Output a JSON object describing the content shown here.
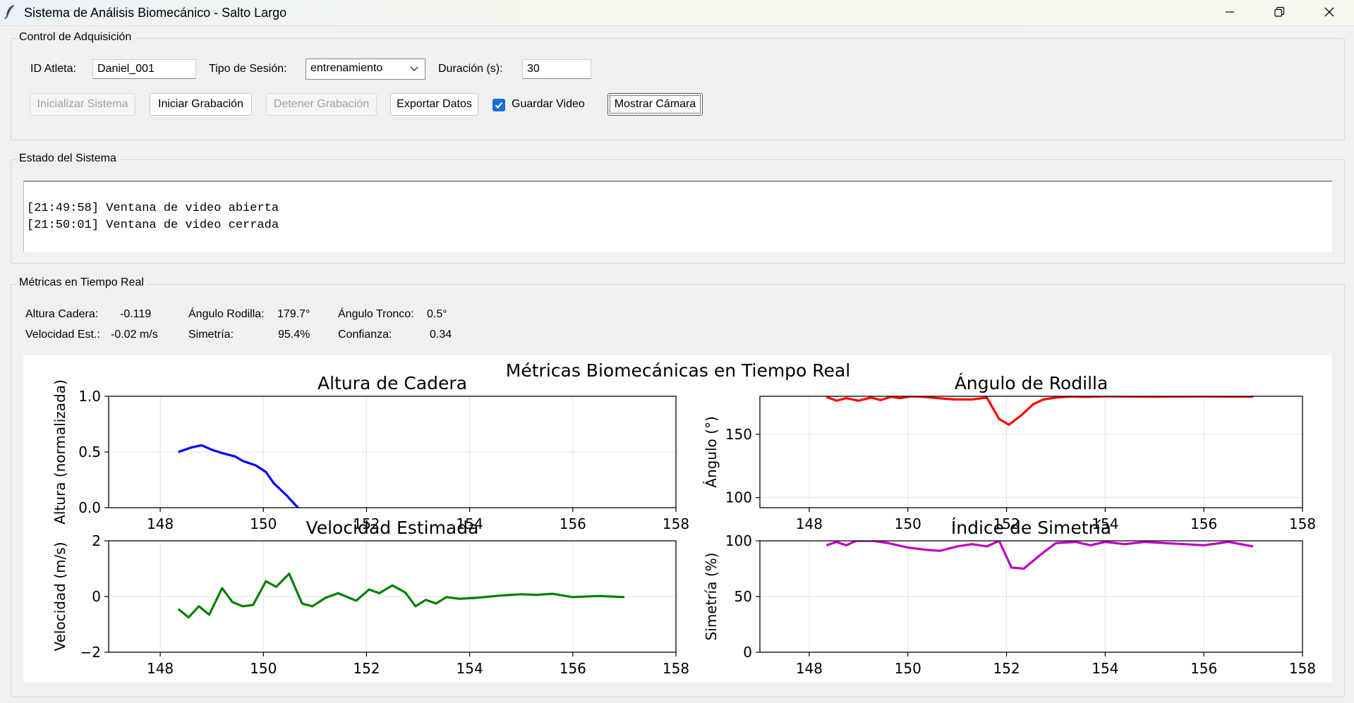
{
  "window": {
    "title": "Sistema de Análisis Biomecánico - Salto Largo",
    "controls": {
      "minimize": "minimize-icon",
      "restore": "restore-icon",
      "close": "close-icon"
    }
  },
  "acquisition": {
    "group_label": "Control de Adquisición",
    "athlete_label": "ID Atleta:",
    "athlete_value": "Daniel_001",
    "session_label": "Tipo de Sesión:",
    "session_value": "entrenamiento",
    "duration_label": "Duración (s):",
    "duration_value": "30",
    "buttons": {
      "init": "Inicializar Sistema",
      "start": "Iniciar Grabación",
      "stop": "Detener Grabación",
      "export": "Exportar Datos",
      "show_camera": "Mostrar Cámara"
    },
    "save_video_label": "Guardar Video",
    "save_video_checked": true
  },
  "status": {
    "group_label": "Estado del Sistema",
    "log": "[21:49:58] Ventana de video abierta\n[21:50:01] Ventana de video cerrada"
  },
  "metrics": {
    "group_label": "Métricas en Tiempo Real",
    "hip_height_label": "Altura Cadera:",
    "hip_height_value": "-0.119",
    "knee_angle_label": "Ángulo Rodilla:",
    "knee_angle_value": "179.7°",
    "trunk_angle_label": "Ángulo Tronco:",
    "trunk_angle_value": "0.5°",
    "velocity_label": "Velocidad Est.:",
    "velocity_value": "-0.02 m/s",
    "symmetry_label": "Simetría:",
    "symmetry_value": "95.4%",
    "confidence_label": "Confianza:",
    "confidence_value": "0.34"
  },
  "figure": {
    "suptitle": "Métricas Biomecánicas en Tiempo Real"
  },
  "chart_data": [
    {
      "type": "line",
      "title": "Altura de Cadera",
      "xlabel": "",
      "ylabel": "Altura (normalizada)",
      "color": "#0000ff",
      "xlim": [
        147,
        158
      ],
      "ylim": [
        0,
        1
      ],
      "xticks": [
        148,
        150,
        152,
        154,
        156,
        158
      ],
      "yticks": [
        0.0,
        0.5,
        1.0
      ],
      "ytick_labels": [
        "0.0",
        "0.5",
        "1.0"
      ],
      "grid": true,
      "x": [
        148.35,
        148.6,
        148.8,
        149.0,
        149.2,
        149.45,
        149.6,
        149.85,
        150.05,
        150.2,
        150.45,
        150.65,
        150.9
      ],
      "y": [
        0.5,
        0.54,
        0.56,
        0.52,
        0.49,
        0.46,
        0.42,
        0.38,
        0.32,
        0.22,
        0.11,
        0.01,
        -0.1
      ]
    },
    {
      "type": "line",
      "title": "Ángulo de Rodilla",
      "xlabel": "",
      "ylabel": "Ángulo (°)",
      "color": "#ff0000",
      "xlim": [
        147,
        158
      ],
      "ylim": [
        92,
        180
      ],
      "xticks": [
        148,
        150,
        152,
        154,
        156,
        158
      ],
      "yticks": [
        100,
        150
      ],
      "ytick_labels": [
        "100",
        "150"
      ],
      "grid": true,
      "x": [
        148.35,
        148.55,
        148.75,
        149.0,
        149.25,
        149.45,
        149.65,
        149.85,
        150.05,
        150.35,
        150.6,
        150.95,
        151.3,
        151.6,
        151.85,
        152.05,
        152.3,
        152.55,
        152.75,
        153.0,
        153.3,
        153.6,
        154.0,
        154.5,
        155.0,
        155.5,
        156.0,
        156.5,
        157.0
      ],
      "y": [
        179.5,
        176.5,
        178.5,
        176.5,
        179.0,
        177.0,
        179.5,
        178.5,
        180.0,
        179.5,
        178.5,
        177.5,
        177.5,
        179.0,
        162.0,
        157.5,
        165.0,
        174.0,
        177.5,
        179.0,
        179.8,
        179.5,
        180.0,
        179.8,
        179.6,
        179.8,
        179.9,
        179.7,
        179.7
      ]
    },
    {
      "type": "line",
      "title": "Velocidad Estimada",
      "xlabel": "",
      "ylabel": "Velocidad (m/s)",
      "color": "#008000",
      "xlim": [
        147,
        158
      ],
      "ylim": [
        -2,
        2
      ],
      "xticks": [
        148,
        150,
        152,
        154,
        156,
        158
      ],
      "yticks": [
        -2,
        0,
        2
      ],
      "ytick_labels": [
        "−2",
        "0",
        "2"
      ],
      "grid": true,
      "x": [
        148.35,
        148.55,
        148.75,
        148.95,
        149.2,
        149.4,
        149.6,
        149.8,
        150.05,
        150.25,
        150.5,
        150.75,
        150.95,
        151.2,
        151.45,
        151.8,
        152.05,
        152.25,
        152.5,
        152.75,
        152.95,
        153.15,
        153.35,
        153.55,
        153.8,
        154.1,
        154.4,
        154.7,
        155.0,
        155.3,
        155.6,
        156.0,
        156.5,
        157.0
      ],
      "y": [
        -0.45,
        -0.75,
        -0.35,
        -0.65,
        0.3,
        -0.2,
        -0.35,
        -0.3,
        0.55,
        0.35,
        0.82,
        -0.25,
        -0.35,
        -0.05,
        0.12,
        -0.15,
        0.25,
        0.12,
        0.4,
        0.15,
        -0.35,
        -0.12,
        -0.25,
        -0.02,
        -0.08,
        -0.05,
        0.0,
        0.05,
        0.08,
        0.06,
        0.1,
        -0.02,
        0.02,
        -0.02
      ]
    },
    {
      "type": "line",
      "title": "Índice de Simetría",
      "xlabel": "",
      "ylabel": "Simetría (%)",
      "color": "#c000c0",
      "xlim": [
        147,
        158
      ],
      "ylim": [
        0,
        100
      ],
      "xticks": [
        148,
        150,
        152,
        154,
        156,
        158
      ],
      "yticks": [
        0,
        50,
        100
      ],
      "ytick_labels": [
        "0",
        "50",
        "100"
      ],
      "grid": true,
      "x": [
        148.35,
        148.55,
        148.75,
        148.95,
        149.3,
        149.6,
        150.0,
        150.35,
        150.65,
        151.0,
        151.3,
        151.6,
        151.85,
        152.1,
        152.35,
        152.7,
        153.0,
        153.4,
        153.7,
        154.0,
        154.4,
        154.8,
        155.2,
        155.6,
        156.0,
        156.5,
        157.0
      ],
      "y": [
        96,
        99,
        96,
        100,
        100,
        98,
        94,
        92,
        91,
        95,
        97,
        95,
        100,
        76,
        75,
        88,
        98,
        99,
        96,
        99,
        97,
        99,
        98,
        97,
        96,
        99,
        95
      ]
    }
  ]
}
